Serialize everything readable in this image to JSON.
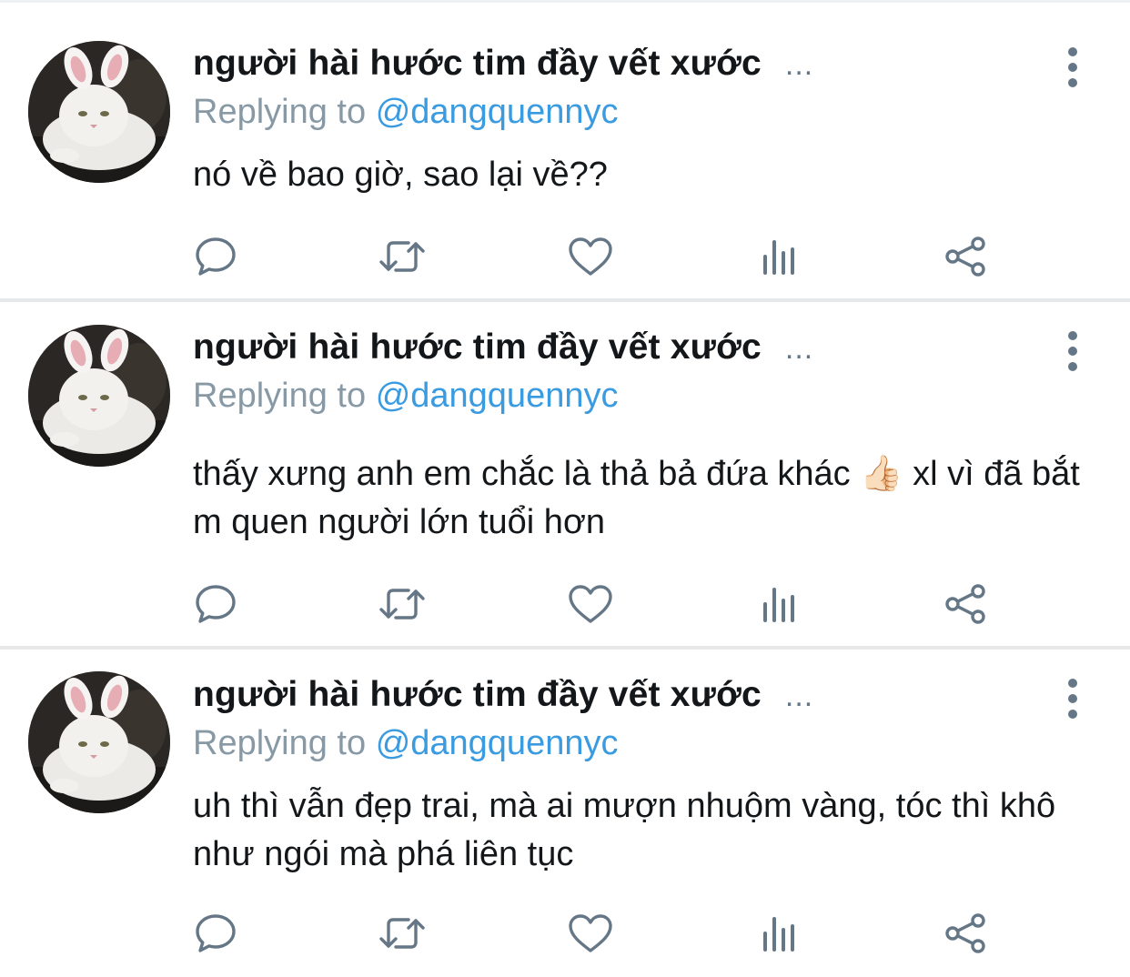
{
  "replies": [
    {
      "display_name": "người hài hước tim đầy vết xước",
      "ellipsis": "...",
      "replying_prefix": "Replying to",
      "replying_handle": "@dangquennyc",
      "text": "nó về bao giờ, sao lại về??"
    },
    {
      "display_name": "người hài hước tim đầy vết xước",
      "ellipsis": "...",
      "replying_prefix": "Replying to",
      "replying_handle": "@dangquennyc",
      "text": "thấy xưng anh em chắc là thả bả đứa khác 👍🏻  xl vì đã bắt m quen người lớn tuổi hơn"
    },
    {
      "display_name": "người hài hước tim đầy vết xước",
      "ellipsis": "...",
      "replying_prefix": "Replying to",
      "replying_handle": "@dangquennyc",
      "text": "uh thì vẫn đẹp trai, mà ai mượn nhuộm vàng, tóc thì khô như ngói mà phá liên tục"
    }
  ],
  "action_icons": [
    "reply-icon",
    "retweet-icon",
    "like-icon",
    "analytics-icon",
    "share-icon"
  ],
  "colors": {
    "text": "#14171a",
    "secondary": "#657786",
    "reply_prefix": "#8899a6",
    "handle": "#3a9be0",
    "divider": "#e6e8ea"
  }
}
